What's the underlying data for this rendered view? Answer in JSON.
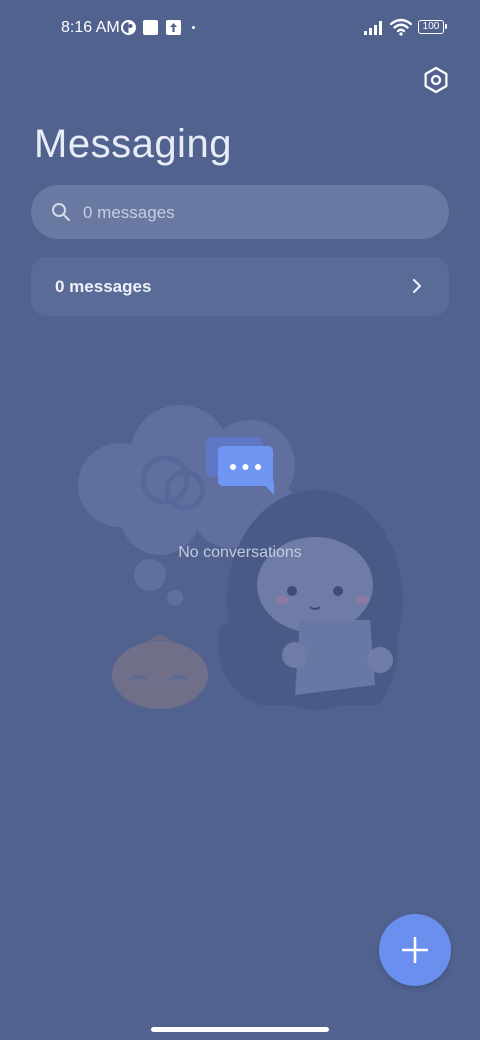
{
  "status_bar": {
    "time": "8:16 AM",
    "battery": "100"
  },
  "header": {
    "title": "Messaging",
    "settings_icon": "settings-hexagon-icon"
  },
  "search": {
    "placeholder": "0 messages"
  },
  "messages_row": {
    "label": "0 messages"
  },
  "empty_state": {
    "text": "No conversations"
  },
  "fab": {
    "icon": "plus-icon"
  },
  "colors": {
    "background": "#51628f",
    "accent": "#6a8fef",
    "search_bg": "#6a79a2",
    "row_bg": "#5b6b97"
  }
}
